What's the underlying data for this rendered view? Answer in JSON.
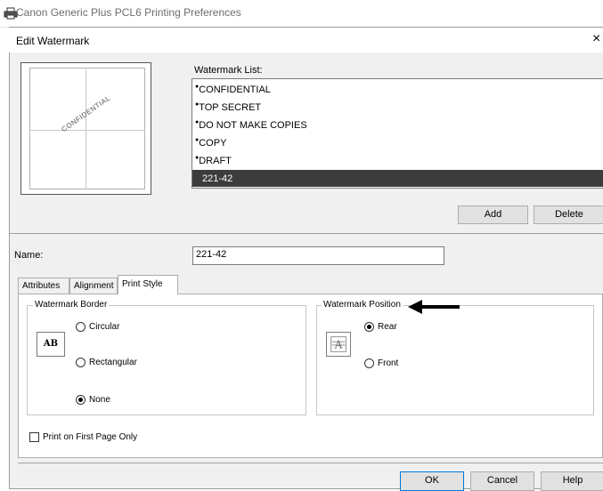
{
  "background_window": {
    "title": "Canon Generic Plus PCL6 Printing Preferences"
  },
  "dialog": {
    "title": "Edit Watermark",
    "close_glyph": "×"
  },
  "preview": {
    "watermark_text": "CONFIDENTIAL"
  },
  "watermark_list": {
    "label": "Watermark List:",
    "items": [
      {
        "label": "CONFIDENTIAL",
        "bullet": "●"
      },
      {
        "label": "TOP SECRET",
        "bullet": "●"
      },
      {
        "label": "DO NOT MAKE COPIES",
        "bullet": "●"
      },
      {
        "label": "COPY",
        "bullet": "●"
      },
      {
        "label": "DRAFT",
        "bullet": "●"
      },
      {
        "label": "221-42",
        "bullet": "",
        "selected": true
      }
    ]
  },
  "buttons": {
    "add": "Add",
    "delete": "Delete",
    "ok": "OK",
    "cancel": "Cancel",
    "help": "Help"
  },
  "name": {
    "label": "Name:",
    "value": "221-42"
  },
  "tabs": [
    {
      "label": "Attributes"
    },
    {
      "label": "Alignment"
    },
    {
      "label": "Print Style",
      "active": true
    }
  ],
  "watermark_border": {
    "title": "Watermark Border",
    "icon_text": "AB",
    "options": [
      {
        "label": "Circular",
        "checked": false
      },
      {
        "label": "Rectangular",
        "checked": false
      },
      {
        "label": "None",
        "checked": true
      }
    ]
  },
  "watermark_position": {
    "title": "Watermark Position",
    "options": [
      {
        "label": "Rear",
        "checked": true
      },
      {
        "label": "Front",
        "checked": false
      }
    ]
  },
  "print_first_page": {
    "label": "Print on First Page Only",
    "checked": false
  },
  "colors": {
    "selection_bg": "#3c3c3c",
    "dialog_bg": "#f0f0f0"
  }
}
